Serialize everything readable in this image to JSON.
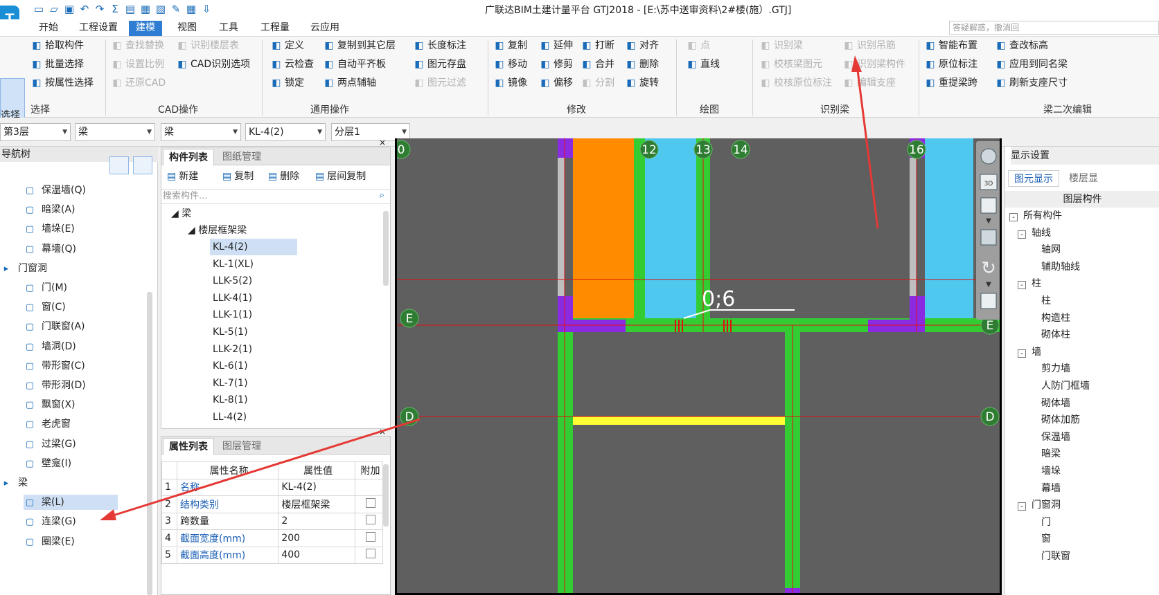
{
  "window": {
    "title": "广联达BIM土建计量平台 GTJ2018 - [E:\\苏中送审资料\\2#楼(施）.GTJ]",
    "logo": "T"
  },
  "quick_access": [
    "save-doc",
    "open",
    "save",
    "undo",
    "redo",
    "sum",
    "report",
    "check",
    "print",
    "pen",
    "grid",
    "export"
  ],
  "menu": {
    "items": [
      "开始",
      "工程设置",
      "建模",
      "视图",
      "工具",
      "工程量",
      "云应用"
    ],
    "active": "建模"
  },
  "help_placeholder": "答疑解惑，撤消回",
  "ribbon": {
    "select_big": "选择",
    "select": [
      "拾取构件",
      "批量选择",
      "按属性选择"
    ],
    "cad": [
      "查找替换",
      "识别楼层表",
      "设置比例",
      "CAD识别选项",
      "还原CAD"
    ],
    "general": [
      "定义",
      "复制到其它层",
      "长度标注",
      "云检查",
      "自动平齐板",
      "图元存盘",
      "锁定",
      "两点辅轴",
      "图元过滤"
    ],
    "modify": [
      "复制",
      "延伸",
      "打断",
      "对齐",
      "移动",
      "修剪",
      "合并",
      "删除",
      "镜像",
      "偏移",
      "分割",
      "旋转"
    ],
    "draw": [
      "点",
      "直线"
    ],
    "recognize": [
      "识别梁",
      "识别吊筋",
      "校核梁图元",
      "识别梁构件",
      "校核原位标注",
      "编辑支座"
    ],
    "beam2": [
      "智能布置",
      "查改标高",
      "原位标注",
      "应用到同名梁",
      "重提梁跨",
      "刷新支座尺寸"
    ],
    "groups": [
      "选择",
      "CAD操作",
      "通用操作",
      "修改",
      "绘图",
      "识别梁",
      "梁二次编辑"
    ]
  },
  "combos": [
    "第3层",
    "梁",
    "梁",
    "KL-4(2)",
    "分层1"
  ],
  "navtree": {
    "header": "导航树",
    "items": [
      {
        "label": "保温墙(Q)",
        "icon": "insulation-wall-icon"
      },
      {
        "label": "暗梁(A)",
        "icon": "hidden-beam-icon"
      },
      {
        "label": "墙垛(E)",
        "icon": "wall-pier-icon"
      },
      {
        "label": "幕墙(Q)",
        "icon": "curtain-wall-icon"
      },
      {
        "label": "门窗洞",
        "icon": "folder-icon",
        "group": true
      },
      {
        "label": "门(M)",
        "icon": "door-icon"
      },
      {
        "label": "窗(C)",
        "icon": "window-icon"
      },
      {
        "label": "门联窗(A)",
        "icon": "door-window-icon"
      },
      {
        "label": "墙洞(D)",
        "icon": "wall-hole-icon"
      },
      {
        "label": "带形窗(C)",
        "icon": "strip-window-icon"
      },
      {
        "label": "带形洞(D)",
        "icon": "strip-hole-icon"
      },
      {
        "label": "飘窗(X)",
        "icon": "bay-window-icon"
      },
      {
        "label": "老虎窗",
        "icon": "dormer-icon"
      },
      {
        "label": "过梁(G)",
        "icon": "lintel-icon"
      },
      {
        "label": "壁龛(I)",
        "icon": "niche-icon"
      },
      {
        "label": "梁",
        "icon": "folder-icon",
        "group": true
      },
      {
        "label": "梁(L)",
        "icon": "beam-icon",
        "selected": true
      },
      {
        "label": "连梁(G)",
        "icon": "coupling-beam-icon"
      },
      {
        "label": "圈梁(E)",
        "icon": "ring-beam-icon"
      }
    ]
  },
  "complist": {
    "tabs": [
      "构件列表",
      "图纸管理"
    ],
    "toolbar": [
      "新建",
      "复制",
      "删除",
      "层间复制"
    ],
    "search_placeholder": "搜索构件...",
    "root": "梁",
    "sub": "楼层框架梁",
    "items": [
      "KL-4(2)",
      "KL-1(XL)",
      "LLK-5(2)",
      "LLK-4(1)",
      "LLK-1(1)",
      "KL-5(1)",
      "LLK-2(1)",
      "KL-6(1)",
      "KL-7(1)",
      "KL-8(1)",
      "LL-4(2)"
    ],
    "selected": "KL-4(2)"
  },
  "proplist": {
    "tabs": [
      "属性列表",
      "图层管理"
    ],
    "headers": [
      "属性名称",
      "属性值",
      "附加"
    ],
    "rows": [
      {
        "n": "1",
        "name": "名称",
        "value": "KL-4(2)",
        "blue": true,
        "check": false
      },
      {
        "n": "2",
        "name": "结构类别",
        "value": "楼层框架梁",
        "blue": true,
        "check": true
      },
      {
        "n": "3",
        "name": "跨数量",
        "value": "2",
        "blue": false,
        "check": true
      },
      {
        "n": "4",
        "name": "截面宽度(mm)",
        "value": "200",
        "blue": true,
        "check": true
      },
      {
        "n": "5",
        "name": "截面高度(mm)",
        "value": "400",
        "blue": true,
        "check": true
      }
    ]
  },
  "canvas": {
    "axis_labels": [
      "0",
      "12",
      "13",
      "14",
      "16",
      "E",
      "E",
      "D",
      "D"
    ],
    "annotation": "0;6",
    "colors": {
      "bg": "#5f5f5f",
      "beam": "#33cc33",
      "column": "#8a2be2",
      "orange": "#ff8c00",
      "cyan": "#4fc8f0",
      "yellow": "#ffff33",
      "axis": "#e01010",
      "arrow": "#e53935"
    }
  },
  "rightpanel": {
    "header": "显示设置",
    "tabs": [
      "图元显示",
      "楼层显"
    ],
    "col": "图层构件",
    "items": [
      {
        "label": "所有构件",
        "lv": 0,
        "box": "-"
      },
      {
        "label": "轴线",
        "lv": 1,
        "box": "-"
      },
      {
        "label": "轴网",
        "lv": 2
      },
      {
        "label": "辅助轴线",
        "lv": 2
      },
      {
        "label": "柱",
        "lv": 1,
        "box": "-"
      },
      {
        "label": "柱",
        "lv": 2
      },
      {
        "label": "构造柱",
        "lv": 2
      },
      {
        "label": "砌体柱",
        "lv": 2
      },
      {
        "label": "墙",
        "lv": 1,
        "box": "-"
      },
      {
        "label": "剪力墙",
        "lv": 2
      },
      {
        "label": "人防门框墙",
        "lv": 2
      },
      {
        "label": "砌体墙",
        "lv": 2
      },
      {
        "label": "砌体加筋",
        "lv": 2
      },
      {
        "label": "保温墙",
        "lv": 2
      },
      {
        "label": "暗梁",
        "lv": 2
      },
      {
        "label": "墙垛",
        "lv": 2
      },
      {
        "label": "幕墙",
        "lv": 2
      },
      {
        "label": "门窗洞",
        "lv": 1,
        "box": "-"
      },
      {
        "label": "门",
        "lv": 2
      },
      {
        "label": "窗",
        "lv": 2
      },
      {
        "label": "门联窗",
        "lv": 2
      }
    ]
  }
}
